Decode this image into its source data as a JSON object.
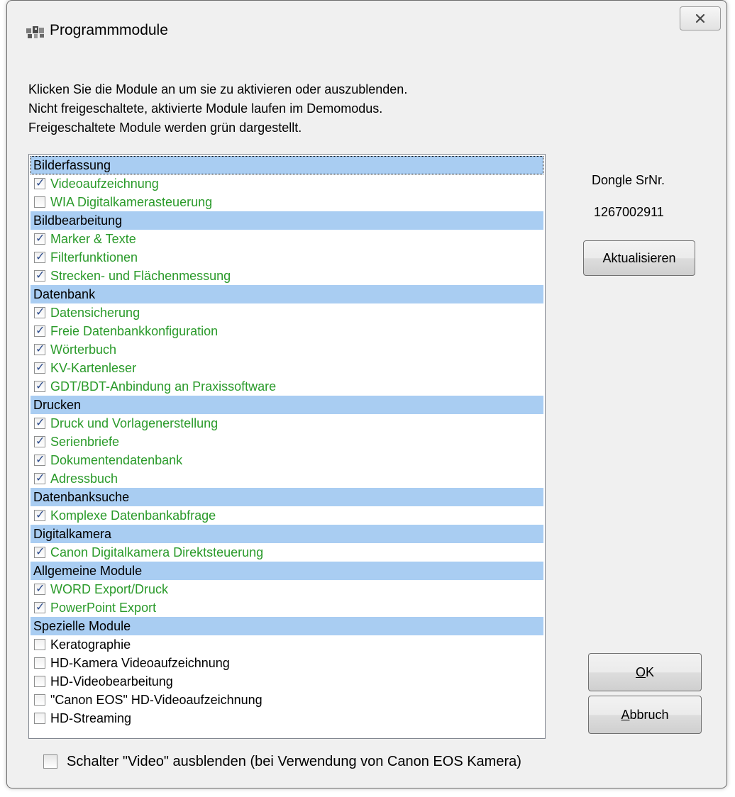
{
  "window": {
    "title": "Programmmodule",
    "icon": "modules-app-icon",
    "close_label": "x"
  },
  "intro": {
    "line1": "Klicken Sie die Module an um sie zu aktivieren oder auszublenden.",
    "line2": "Nicht freigeschaltete, aktivierte  Module laufen im Demomodus.",
    "line3": "Freigeschaltete Module werden grün dargestellt."
  },
  "colors": {
    "unlocked_text": "#2a9a2a",
    "group_header_bg": "#a9cdf2",
    "checkmark": "#2b4a8a"
  },
  "groups": [
    {
      "title": "Bilderfassung",
      "items": [
        {
          "label": "Videoaufzeichnung",
          "checked": true,
          "unlocked": true
        },
        {
          "label": "WIA Digitalkamerasteuerung",
          "checked": false,
          "unlocked": true
        }
      ]
    },
    {
      "title": "Bildbearbeitung",
      "items": [
        {
          "label": "Marker & Texte",
          "checked": true,
          "unlocked": true
        },
        {
          "label": "Filterfunktionen",
          "checked": true,
          "unlocked": true
        },
        {
          "label": "Strecken- und Flächenmessung",
          "checked": true,
          "unlocked": true
        }
      ]
    },
    {
      "title": "Datenbank",
      "items": [
        {
          "label": "Datensicherung",
          "checked": true,
          "unlocked": true
        },
        {
          "label": "Freie Datenbankkonfiguration",
          "checked": true,
          "unlocked": true
        },
        {
          "label": "Wörterbuch",
          "checked": true,
          "unlocked": true
        },
        {
          "label": "KV-Kartenleser",
          "checked": true,
          "unlocked": true
        },
        {
          "label": "GDT/BDT-Anbindung an Praxissoftware",
          "checked": true,
          "unlocked": true
        }
      ]
    },
    {
      "title": "Drucken",
      "items": [
        {
          "label": "Druck und Vorlagenerstellung",
          "checked": true,
          "unlocked": true
        },
        {
          "label": "Serienbriefe",
          "checked": true,
          "unlocked": true
        },
        {
          "label": "Dokumentendatenbank",
          "checked": true,
          "unlocked": true
        },
        {
          "label": "Adressbuch",
          "checked": true,
          "unlocked": true
        }
      ]
    },
    {
      "title": "Datenbanksuche",
      "items": [
        {
          "label": "Komplexe Datenbankabfrage",
          "checked": true,
          "unlocked": true
        }
      ]
    },
    {
      "title": "Digitalkamera",
      "items": [
        {
          "label": "Canon Digitalkamera Direktsteuerung",
          "checked": true,
          "unlocked": true
        }
      ]
    },
    {
      "title": "Allgemeine Module",
      "items": [
        {
          "label": "WORD Export/Druck",
          "checked": true,
          "unlocked": true
        },
        {
          "label": "PowerPoint Export",
          "checked": true,
          "unlocked": true
        }
      ]
    },
    {
      "title": "Spezielle Module",
      "items": [
        {
          "label": "Keratographie",
          "checked": false,
          "unlocked": false
        },
        {
          "label": "HD-Kamera Videoaufzeichnung",
          "checked": false,
          "unlocked": false
        },
        {
          "label": "HD-Videobearbeitung",
          "checked": false,
          "unlocked": false
        },
        {
          "label": "\"Canon EOS\" HD-Videoaufzeichnung",
          "checked": false,
          "unlocked": false
        },
        {
          "label": "HD-Streaming",
          "checked": false,
          "unlocked": false
        }
      ]
    }
  ],
  "dongle": {
    "label": "Dongle SrNr.",
    "value": "1267002911"
  },
  "buttons": {
    "refresh": "Aktualisieren",
    "ok_mnemonic": "O",
    "ok_rest": "K",
    "cancel_mnemonic": "A",
    "cancel_rest": "bbruch"
  },
  "options": {
    "hide_video_label": "Schalter \"Video\" ausblenden (bei Verwendung von Canon EOS Kamera)",
    "hide_video_checked": false
  }
}
